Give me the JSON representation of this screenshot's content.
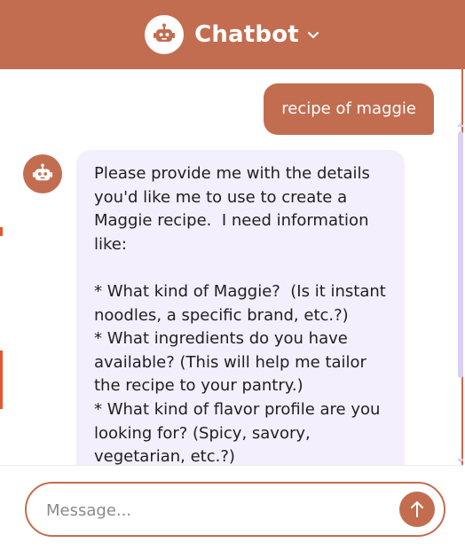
{
  "header": {
    "title": "Chatbot",
    "icons": [
      "robot-icon",
      "chevron-down-icon"
    ]
  },
  "messages": [
    {
      "role": "user",
      "text": "recipe of maggie"
    },
    {
      "role": "bot",
      "text": "Please provide me with the details you'd like me to use to create a Maggie recipe.  I need information like:\n\n* What kind of Maggie?  (Is it instant noodles, a specific brand, etc.?)\n* What ingredients do you have available? (This will help me tailor the recipe to your pantry.)\n* What kind of flavor profile are you looking for? (Spicy, savory, vegetarian, etc.?)"
    }
  ],
  "composer": {
    "placeholder": "Message...",
    "value": "",
    "send_icon": "arrow-up-icon"
  },
  "colors": {
    "accent": "#c26d50",
    "bot_bubble": "#f3effc",
    "scrollbar": "#d9d0f3"
  }
}
